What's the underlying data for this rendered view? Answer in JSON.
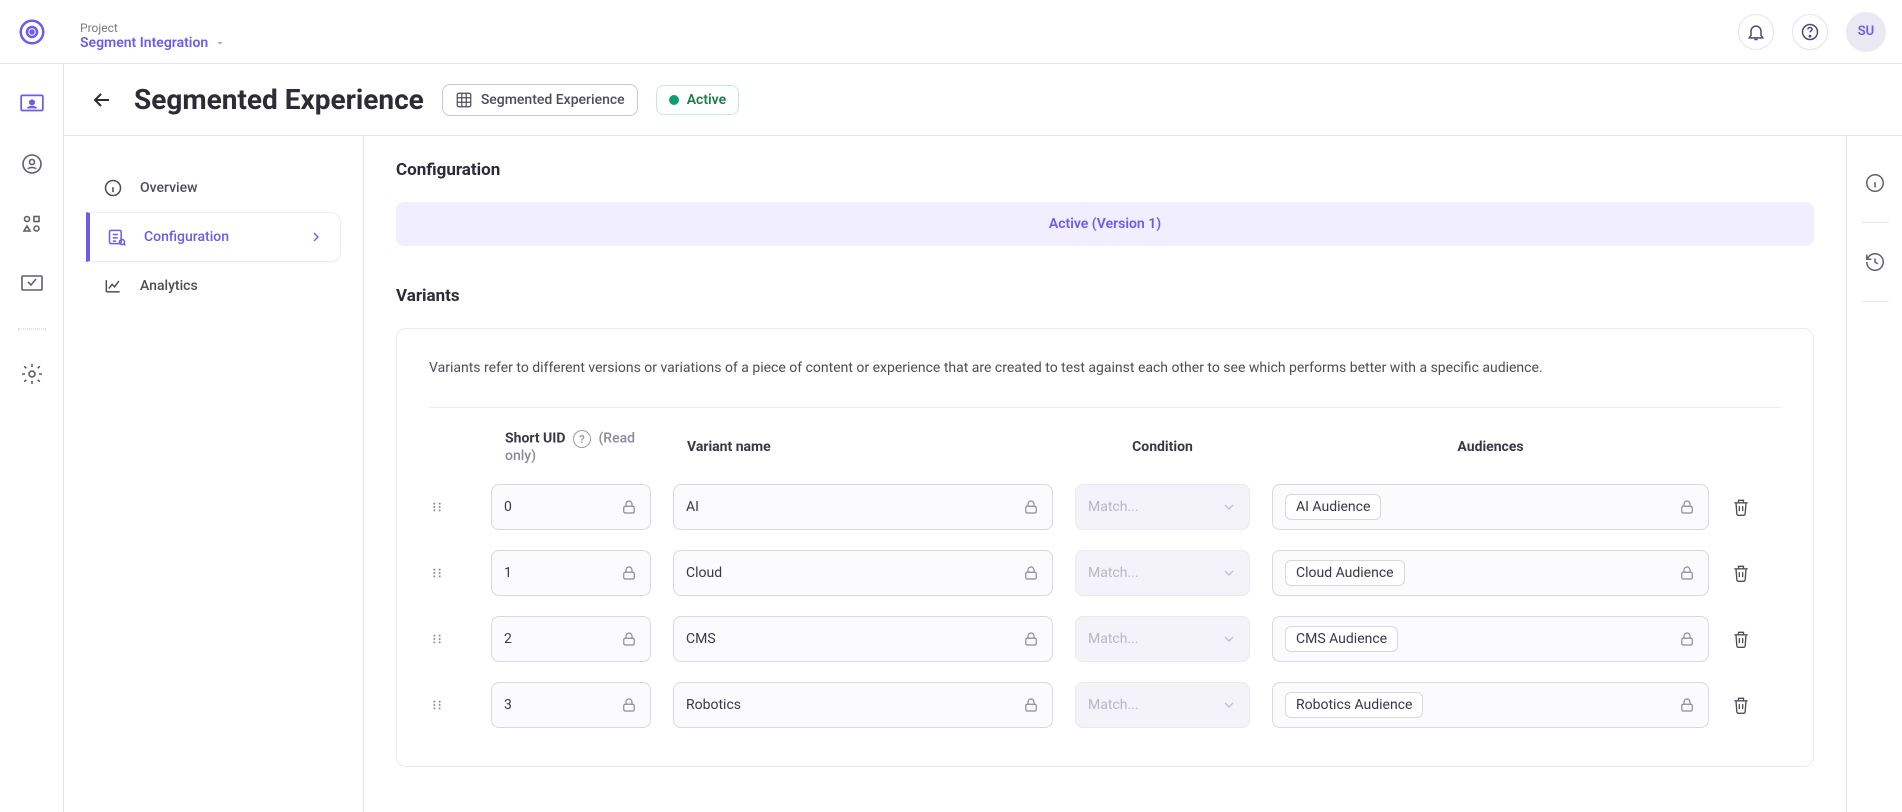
{
  "project": {
    "label": "Project",
    "name": "Segment Integration"
  },
  "user": {
    "initials": "SU"
  },
  "page": {
    "title": "Segmented Experience",
    "tag": "Segmented Experience",
    "status": "Active"
  },
  "sidenav": {
    "overview_label": "Overview",
    "configuration_label": "Configuration",
    "analytics_label": "Analytics"
  },
  "content": {
    "section_title": "Configuration",
    "banner": "Active (Version 1)",
    "variants_heading": "Variants",
    "variants_desc": "Variants refer to different versions or variations of a piece of content or experience that are created to test against each other to see which performs better with a specific audience.",
    "headers": {
      "short_uid": "Short UID",
      "read_only": "(Read only)",
      "variant_name": "Variant name",
      "condition": "Condition",
      "audiences": "Audiences"
    },
    "condition_placeholder": "Match...",
    "rows": [
      {
        "uid": "0",
        "name": "AI",
        "audience": "AI Audience"
      },
      {
        "uid": "1",
        "name": "Cloud",
        "audience": "Cloud Audience"
      },
      {
        "uid": "2",
        "name": "CMS",
        "audience": "CMS Audience"
      },
      {
        "uid": "3",
        "name": "Robotics",
        "audience": "Robotics Audience"
      }
    ]
  }
}
